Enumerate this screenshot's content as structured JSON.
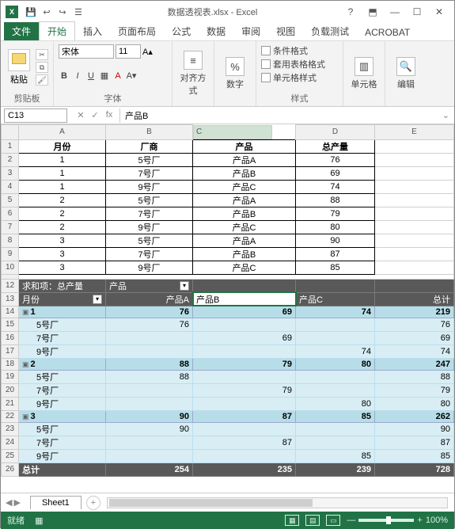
{
  "window": {
    "title": "数据透视表.xlsx - Excel",
    "qat": [
      "↩",
      "↪",
      "☰",
      "✎"
    ],
    "wbuttons": [
      "?",
      "⬒",
      "—",
      "☐",
      "✕"
    ]
  },
  "tabs": {
    "file": "文件",
    "home": "开始",
    "insert": "插入",
    "layout": "页面布局",
    "formula": "公式",
    "data": "数据",
    "review": "审阅",
    "view": "视图",
    "load": "负载测试",
    "acrobat": "ACROBAT"
  },
  "ribbon": {
    "clip": {
      "paste": "粘贴",
      "label": "剪贴板"
    },
    "font": {
      "name": "宋体",
      "size": "11",
      "label": "字体"
    },
    "align": {
      "label": "对齐方式"
    },
    "num": {
      "label": "数字"
    },
    "style": {
      "cond": "条件格式",
      "tbl": "套用表格格式",
      "cell": "单元格样式",
      "label": "样式"
    },
    "cells": {
      "label": "单元格"
    },
    "edit": {
      "label": "编辑"
    }
  },
  "fbar": {
    "name": "C13",
    "fx": "fx",
    "value": "产品B"
  },
  "cols": [
    "A",
    "B",
    "C",
    "D",
    "E"
  ],
  "head": [
    "月份",
    "厂商",
    "产品",
    "总产量"
  ],
  "rows": [
    [
      "1",
      "5号厂",
      "产品A",
      "76"
    ],
    [
      "1",
      "7号厂",
      "产品B",
      "69"
    ],
    [
      "1",
      "9号厂",
      "产品C",
      "74"
    ],
    [
      "2",
      "5号厂",
      "产品A",
      "88"
    ],
    [
      "2",
      "7号厂",
      "产品B",
      "79"
    ],
    [
      "2",
      "9号厂",
      "产品C",
      "80"
    ],
    [
      "3",
      "5号厂",
      "产品A",
      "90"
    ],
    [
      "3",
      "7号厂",
      "产品B",
      "87"
    ],
    [
      "3",
      "9号厂",
      "产品C",
      "85"
    ]
  ],
  "pvt": {
    "sum": "求和项：总产量",
    "prod": "产品",
    "month": "月份",
    "pA": "产品A",
    "pB": "产品B",
    "pC": "产品C",
    "tot": "总计",
    "g1": {
      "m": "1",
      "a": "76",
      "b": "69",
      "c": "74",
      "t": "219",
      "f5": "5号厂",
      "f7": "7号厂",
      "f9": "9号厂",
      "v5": "76",
      "v7": "69",
      "v9": "74"
    },
    "g2": {
      "m": "2",
      "a": "88",
      "b": "79",
      "c": "80",
      "t": "247",
      "f5": "5号厂",
      "f7": "7号厂",
      "f9": "9号厂",
      "v5": "88",
      "v7": "79",
      "v9": "80"
    },
    "g3": {
      "m": "3",
      "a": "90",
      "b": "87",
      "c": "85",
      "t": "262",
      "f5": "5号厂",
      "f7": "7号厂",
      "f9": "9号厂",
      "v5": "90",
      "v7": "87",
      "v9": "85"
    },
    "fa": "254",
    "fb": "235",
    "fc": "239",
    "ft": "728"
  },
  "tabbar": {
    "sheet": "Sheet1"
  },
  "status": {
    "ready": "就绪",
    "zoom": "100%"
  }
}
